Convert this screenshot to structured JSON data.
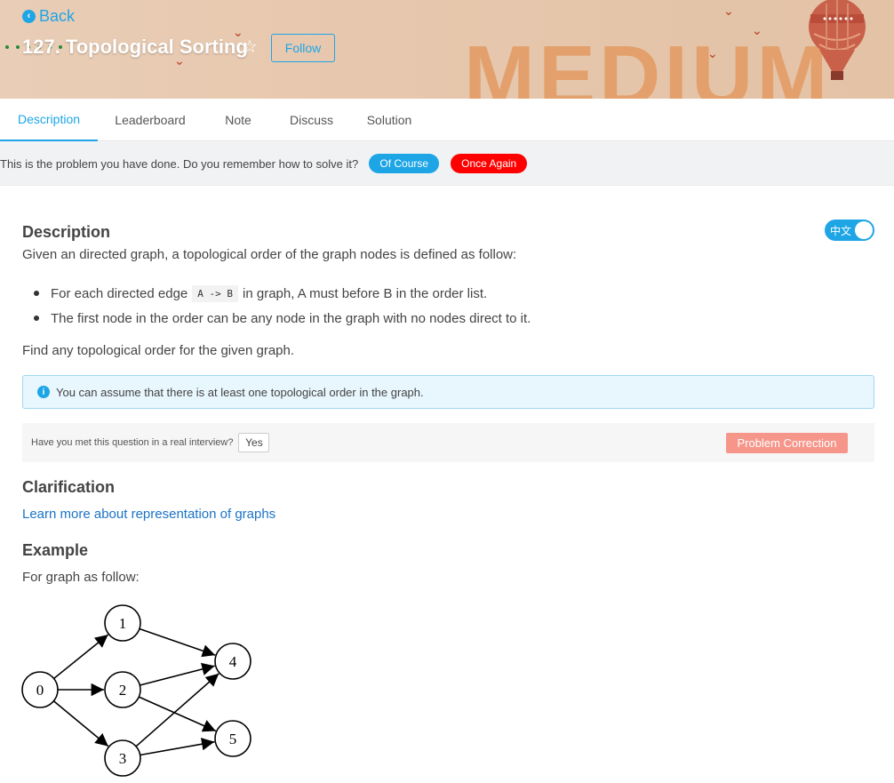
{
  "header": {
    "back_label": "Back",
    "problem_title": "127. Topological Sorting",
    "follow_label": "Follow",
    "difficulty_watermark": "MEDIUM"
  },
  "tabs": [
    {
      "label": "Description",
      "active": true
    },
    {
      "label": "Leaderboard",
      "active": false
    },
    {
      "label": "Note",
      "active": false
    },
    {
      "label": "Discuss",
      "active": false
    },
    {
      "label": "Solution",
      "active": false
    }
  ],
  "notice": {
    "message": "This is the problem you have done. Do you remember how to solve it?",
    "of_course_label": "Of Course",
    "once_again_label": "Once Again"
  },
  "content": {
    "lang_toggle_label": "中文",
    "description_heading": "Description",
    "description_text": "Given an directed graph, a topological order of the graph nodes is defined as follow:",
    "bullet1_prefix": "For each directed edge",
    "bullet1_code": "A -> B",
    "bullet1_suffix": "in graph, A must before B in the order list.",
    "bullet2": "The first node in the order can be any node in the graph with no nodes direct to it.",
    "find_text": "Find any topological order for the given graph.",
    "info_text": "You can assume that there is at least one topological order in the graph.",
    "interview_question": "Have you met this question in a real interview?",
    "yes_label": "Yes",
    "problem_correction_label": "Problem Correction",
    "clarification_heading": "Clarification",
    "clarification_link": "Learn more about representation of graphs",
    "example_heading": "Example",
    "example_text": "For graph as follow:"
  },
  "graph": {
    "nodes": [
      "0",
      "1",
      "2",
      "3",
      "4",
      "5"
    ],
    "edges": [
      [
        "0",
        "1"
      ],
      [
        "0",
        "2"
      ],
      [
        "0",
        "3"
      ],
      [
        "1",
        "4"
      ],
      [
        "2",
        "4"
      ],
      [
        "2",
        "5"
      ],
      [
        "3",
        "4"
      ],
      [
        "3",
        "5"
      ]
    ]
  },
  "colors": {
    "accent": "#1ea5e6",
    "danger": "#ff0000",
    "correction": "#f6968b",
    "link": "#1a73c7"
  }
}
